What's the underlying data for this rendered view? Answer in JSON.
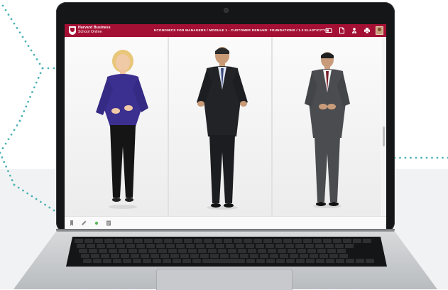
{
  "header": {
    "logo_line1": "Harvard Business",
    "logo_line2": "School Online",
    "breadcrumb": "ECONOMICS FOR MANAGERS / MODULE 1 - CUSTOMER DEMAND: FOUNDATIONS / 1.3 ELASTICITY",
    "icons": [
      "video-layout-icon",
      "document-icon",
      "person-upload-icon",
      "print-icon",
      "user-avatar"
    ]
  },
  "toolbar": {
    "icons": [
      "bookmark-icon",
      "pencil-icon",
      "status-dot-icon",
      "notes-icon"
    ],
    "status_color": "#5cb85c"
  },
  "colors": {
    "brand": "#a41034",
    "accent_dots": "#4db3b6"
  },
  "presenters": [
    {
      "label": "presenter-left",
      "suit": "#3b2f8f"
    },
    {
      "label": "presenter-center",
      "suit": "#222326"
    },
    {
      "label": "presenter-right",
      "suit": "#4a4c4f"
    }
  ]
}
